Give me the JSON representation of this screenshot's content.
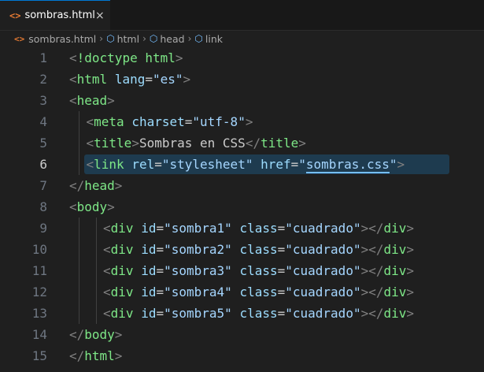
{
  "tab": {
    "label": "sombras.html",
    "icon": "html-file-icon",
    "close": "×"
  },
  "breadcrumb": {
    "file": "sombras.html",
    "items": [
      "html",
      "head",
      "link"
    ]
  },
  "editor": {
    "active_line": 6,
    "lines": [
      {
        "n": "1",
        "indent": 0,
        "tokens": [
          [
            "p",
            "<"
          ],
          [
            "tg",
            "!doctype"
          ],
          [
            "txt",
            " "
          ],
          [
            "tg",
            "html"
          ],
          [
            "p",
            ">"
          ]
        ]
      },
      {
        "n": "2",
        "indent": 0,
        "tokens": [
          [
            "p",
            "<"
          ],
          [
            "tg",
            "html"
          ],
          [
            "txt",
            " "
          ],
          [
            "a",
            "lang"
          ],
          [
            "txt",
            "="
          ],
          [
            "str2",
            "\"es\""
          ],
          [
            "p",
            ">"
          ]
        ]
      },
      {
        "n": "3",
        "indent": 0,
        "tokens": [
          [
            "p",
            "<"
          ],
          [
            "tg",
            "head"
          ],
          [
            "p",
            ">"
          ]
        ]
      },
      {
        "n": "4",
        "indent": 1,
        "tokens": [
          [
            "p",
            "<"
          ],
          [
            "tg",
            "meta"
          ],
          [
            "txt",
            " "
          ],
          [
            "a",
            "charset"
          ],
          [
            "txt",
            "="
          ],
          [
            "str2",
            "\"utf-8\""
          ],
          [
            "p",
            ">"
          ]
        ]
      },
      {
        "n": "5",
        "indent": 1,
        "tokens": [
          [
            "p",
            "<"
          ],
          [
            "tg",
            "title"
          ],
          [
            "p",
            ">"
          ],
          [
            "txt",
            "Sombras en CSS"
          ],
          [
            "p",
            "</"
          ],
          [
            "tg",
            "title"
          ],
          [
            "p",
            ">"
          ]
        ]
      },
      {
        "n": "6",
        "indent": 1,
        "tokens": [
          [
            "p",
            "<"
          ],
          [
            "tg",
            "link"
          ],
          [
            "txt",
            " "
          ],
          [
            "a",
            "rel"
          ],
          [
            "txt",
            "="
          ],
          [
            "str2",
            "\"stylesheet\""
          ],
          [
            "txt",
            " "
          ],
          [
            "a",
            "href"
          ],
          [
            "txt",
            "="
          ],
          [
            "str2",
            "\""
          ],
          [
            "str2u",
            "sombras.css"
          ],
          [
            "str2",
            "\""
          ],
          [
            "p",
            ">"
          ]
        ]
      },
      {
        "n": "7",
        "indent": 0,
        "tokens": [
          [
            "p",
            "</"
          ],
          [
            "tg",
            "head"
          ],
          [
            "p",
            ">"
          ]
        ]
      },
      {
        "n": "8",
        "indent": 0,
        "tokens": [
          [
            "p",
            "<"
          ],
          [
            "tg",
            "body"
          ],
          [
            "p",
            ">"
          ]
        ]
      },
      {
        "n": "9",
        "indent": 2,
        "tokens": [
          [
            "p",
            "<"
          ],
          [
            "tg",
            "div"
          ],
          [
            "txt",
            " "
          ],
          [
            "a",
            "id"
          ],
          [
            "txt",
            "="
          ],
          [
            "str2",
            "\"sombra1\""
          ],
          [
            "txt",
            " "
          ],
          [
            "a",
            "class"
          ],
          [
            "txt",
            "="
          ],
          [
            "str2",
            "\"cuadrado\""
          ],
          [
            "p",
            "></"
          ],
          [
            "tg",
            "div"
          ],
          [
            "p",
            ">"
          ]
        ]
      },
      {
        "n": "10",
        "indent": 2,
        "tokens": [
          [
            "p",
            "<"
          ],
          [
            "tg",
            "div"
          ],
          [
            "txt",
            " "
          ],
          [
            "a",
            "id"
          ],
          [
            "txt",
            "="
          ],
          [
            "str2",
            "\"sombra2\""
          ],
          [
            "txt",
            " "
          ],
          [
            "a",
            "class"
          ],
          [
            "txt",
            "="
          ],
          [
            "str2",
            "\"cuadrado\""
          ],
          [
            "p",
            "></"
          ],
          [
            "tg",
            "div"
          ],
          [
            "p",
            ">"
          ]
        ]
      },
      {
        "n": "11",
        "indent": 2,
        "tokens": [
          [
            "p",
            "<"
          ],
          [
            "tg",
            "div"
          ],
          [
            "txt",
            " "
          ],
          [
            "a",
            "id"
          ],
          [
            "txt",
            "="
          ],
          [
            "str2",
            "\"sombra3\""
          ],
          [
            "txt",
            " "
          ],
          [
            "a",
            "class"
          ],
          [
            "txt",
            "="
          ],
          [
            "str2",
            "\"cuadrado\""
          ],
          [
            "p",
            "></"
          ],
          [
            "tg",
            "div"
          ],
          [
            "p",
            ">"
          ]
        ]
      },
      {
        "n": "12",
        "indent": 2,
        "tokens": [
          [
            "p",
            "<"
          ],
          [
            "tg",
            "div"
          ],
          [
            "txt",
            " "
          ],
          [
            "a",
            "id"
          ],
          [
            "txt",
            "="
          ],
          [
            "str2",
            "\"sombra4\""
          ],
          [
            "txt",
            " "
          ],
          [
            "a",
            "class"
          ],
          [
            "txt",
            "="
          ],
          [
            "str2",
            "\"cuadrado\""
          ],
          [
            "p",
            "></"
          ],
          [
            "tg",
            "div"
          ],
          [
            "p",
            ">"
          ]
        ]
      },
      {
        "n": "13",
        "indent": 2,
        "tokens": [
          [
            "p",
            "<"
          ],
          [
            "tg",
            "div"
          ],
          [
            "txt",
            " "
          ],
          [
            "a",
            "id"
          ],
          [
            "txt",
            "="
          ],
          [
            "str2",
            "\"sombra5\""
          ],
          [
            "txt",
            " "
          ],
          [
            "a",
            "class"
          ],
          [
            "txt",
            "="
          ],
          [
            "str2",
            "\"cuadrado\""
          ],
          [
            "p",
            "></"
          ],
          [
            "tg",
            "div"
          ],
          [
            "p",
            ">"
          ]
        ]
      },
      {
        "n": "14",
        "indent": 0,
        "tokens": [
          [
            "p",
            "</"
          ],
          [
            "tg",
            "body"
          ],
          [
            "p",
            ">"
          ]
        ]
      },
      {
        "n": "15",
        "indent": 0,
        "tokens": [
          [
            "p",
            "</"
          ],
          [
            "tg",
            "html"
          ],
          [
            "p",
            ">"
          ]
        ]
      }
    ]
  }
}
